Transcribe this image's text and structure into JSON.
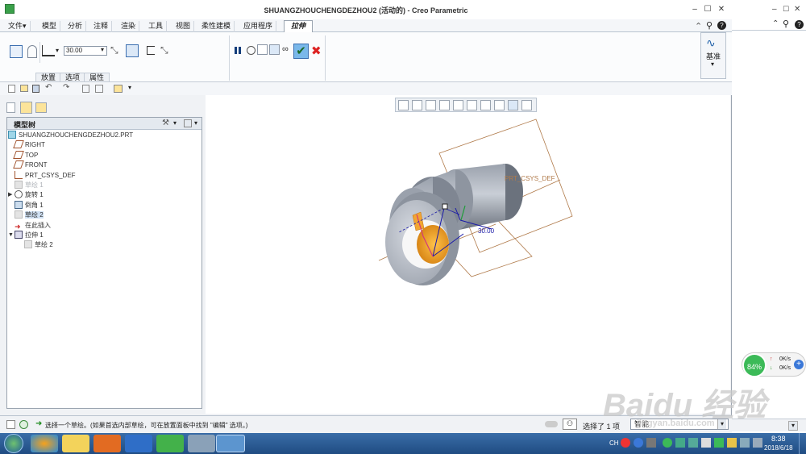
{
  "window": {
    "title": "SHUANGZHOUCHENGDEZHOU2 (活动的) - Creo Parametric",
    "min": "–",
    "max": "☐",
    "close": "✕"
  },
  "menu": {
    "file": "文件▾",
    "tabs": [
      "模型",
      "分析",
      "注释",
      "渲染",
      "工具",
      "视图",
      "柔性建模",
      "应用程序"
    ],
    "active_tab": "拉伸"
  },
  "ribbon": {
    "depth_value": "30.00",
    "group_tabs": [
      "放置",
      "选项",
      "属性"
    ],
    "datum_label": "基准"
  },
  "tree": {
    "header": "模型树",
    "items": [
      {
        "label": "SHUANGZHOUCHENGDEZHOU2.PRT",
        "icon": "part-icon",
        "dim": false
      },
      {
        "label": "RIGHT",
        "icon": "plane-icon",
        "dim": false
      },
      {
        "label": "TOP",
        "icon": "plane-icon",
        "dim": false
      },
      {
        "label": "FRONT",
        "icon": "plane-icon",
        "dim": false
      },
      {
        "label": "PRT_CSYS_DEF",
        "icon": "csys-icon",
        "dim": false
      },
      {
        "label": "草绘 1",
        "icon": "sketch-icon",
        "dim": true
      },
      {
        "label": "旋转 1",
        "icon": "revolve-icon",
        "dim": false
      },
      {
        "label": "倒角 1",
        "icon": "chamfer-icon",
        "dim": false
      },
      {
        "label": "草绘 2",
        "icon": "sketch-icon",
        "dim": false,
        "selected": true
      },
      {
        "label": "在此插入",
        "icon": "insert-arrow-icon",
        "dim": false
      },
      {
        "label": "拉伸 1",
        "icon": "extrude-icon",
        "dim": false
      },
      {
        "label": "草绘 2",
        "icon": "sketch-icon",
        "dim": false
      }
    ]
  },
  "viewport": {
    "csys_label": "PRT_CSYS_DEF",
    "dim_label": "30.00"
  },
  "status": {
    "message": "选择一个草绘。(如果首选内部草绘，可在放置面板中找到 \"编辑\" 选项。)",
    "selected": "选择了 1 项",
    "filter": "智能"
  },
  "net_widget": {
    "percent": "84%",
    "up": "0K/s",
    "down": "0K/s"
  },
  "taskbar": {
    "lang": "CH",
    "time": "8:38",
    "date": "2018/6/18"
  },
  "watermark": {
    "brand": "Baidu 经验",
    "url": "jingyan.baidu.com"
  },
  "colors": {
    "accent": "#2a7fd4",
    "ok": "#3bb54a",
    "cancel": "#d22",
    "part_face": "#c8ccd4",
    "part_inner": "#f0a020"
  }
}
